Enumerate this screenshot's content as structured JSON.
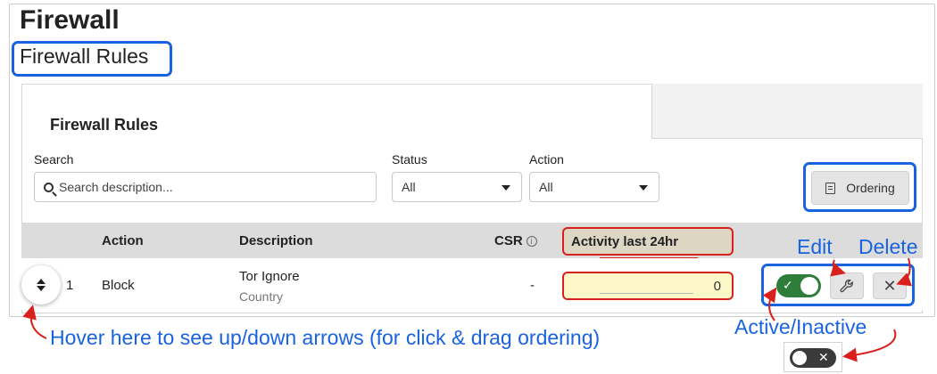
{
  "page": {
    "title": "Firewall",
    "subtitle": "Firewall Rules"
  },
  "panel": {
    "title": "Firewall Rules"
  },
  "filters": {
    "search_label": "Search",
    "search_placeholder": "Search description...",
    "status_label": "Status",
    "status_value": "All",
    "action_label": "Action",
    "action_value": "All",
    "ordering_label": "Ordering"
  },
  "table": {
    "headers": {
      "action": "Action",
      "description": "Description",
      "csr": "CSR",
      "activity": "Activity last 24hr"
    },
    "rows": [
      {
        "index": "1",
        "action": "Block",
        "description": "Tor Ignore",
        "description_sub": "Country",
        "csr": "-",
        "activity": "0",
        "active": true
      }
    ]
  },
  "annotations": {
    "edit": "Edit",
    "delete": "Delete",
    "active_inactive": "Active/Inactive",
    "hover_hint": "Hover here to see up/down arrows (for click & drag ordering)"
  },
  "icons": {
    "info": "info-icon",
    "search": "search-icon",
    "ordering": "ordering-icon",
    "edit": "wrench-icon",
    "delete": "close-icon",
    "drag": "sort-arrows-icon"
  },
  "colors": {
    "annotation_blue": "#1a63e0",
    "annotation_red": "#d9201c",
    "toggle_on": "#2e7d3a",
    "activity_bg": "#fdf8c8"
  }
}
